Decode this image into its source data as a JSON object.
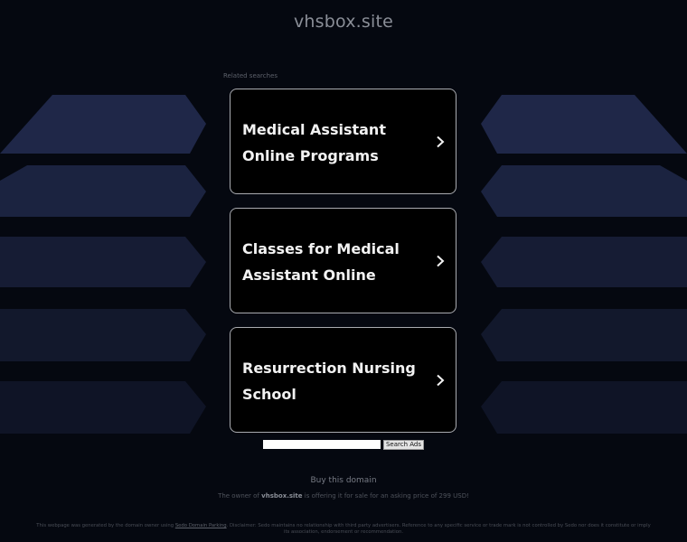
{
  "header": {
    "domain": "vhsbox.site"
  },
  "related_label": "Related searches",
  "cards": [
    {
      "label": "Medical Assistant Online Programs",
      "icon": "chevron-right-icon"
    },
    {
      "label": "Classes for Medical Assistant Online",
      "icon": "chevron-right-icon"
    },
    {
      "label": "Resurrection Nursing School",
      "icon": "chevron-right-icon"
    }
  ],
  "search": {
    "value": "",
    "button_label": "Search Ads"
  },
  "buy": {
    "label": "Buy this domain"
  },
  "owner": {
    "prefix": "The owner of",
    "domain": "vhsbox.site",
    "suffix": "is offering it for sale for an asking price of 299 USD!"
  },
  "footer": {
    "text1": "This webpage was generated by the domain owner using",
    "link": "Sedo Domain Parking",
    "text2": ". Disclaimer: Sedo maintains no relationship with third party advertisers. Reference to any specific service or trade mark is not controlled by Sedo nor does it constitute or imply its association, endorsement or recommendation."
  },
  "colors": {
    "background": "#050810",
    "card_border": "#a9abb0",
    "shape_bright": "#1f2748",
    "shape_dim": "#0f1426"
  }
}
